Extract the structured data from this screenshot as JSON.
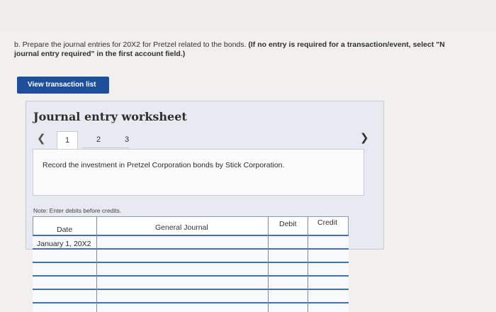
{
  "instructions": {
    "part1": "b. Prepare the journal entries for 20X2 for Pretzel related to the bonds. ",
    "part2": "(If no entry is required for a transaction/event, select \"N",
    "part3": "journal entry required\" in the first account field.)"
  },
  "view_button_label": "View transaction list",
  "worksheet": {
    "title": "Journal entry worksheet",
    "tabs": [
      "1",
      "2",
      "3"
    ],
    "active_tab": "1",
    "record_text": "Record the investment in Pretzel Corporation bonds by Stick Corporation.",
    "note": "Note: Enter debits before credits."
  },
  "journal": {
    "headers": {
      "date": "Date",
      "account": "General Journal",
      "debit": "Debit",
      "credit": "Credit"
    },
    "rows": [
      {
        "date": "January 1, 20X2",
        "account": "",
        "debit": "",
        "credit": ""
      },
      {
        "date": "",
        "account": "",
        "debit": "",
        "credit": ""
      },
      {
        "date": "",
        "account": "",
        "debit": "",
        "credit": ""
      },
      {
        "date": "",
        "account": "",
        "debit": "",
        "credit": ""
      },
      {
        "date": "",
        "account": "",
        "debit": "",
        "credit": ""
      },
      {
        "date": "",
        "account": "",
        "debit": "",
        "credit": ""
      }
    ]
  },
  "icons": {
    "prev": "chevron-left-icon",
    "next": "chevron-right-icon"
  },
  "colors": {
    "button_bg": "#1f4f9c",
    "row_line": "#3f71b8"
  }
}
